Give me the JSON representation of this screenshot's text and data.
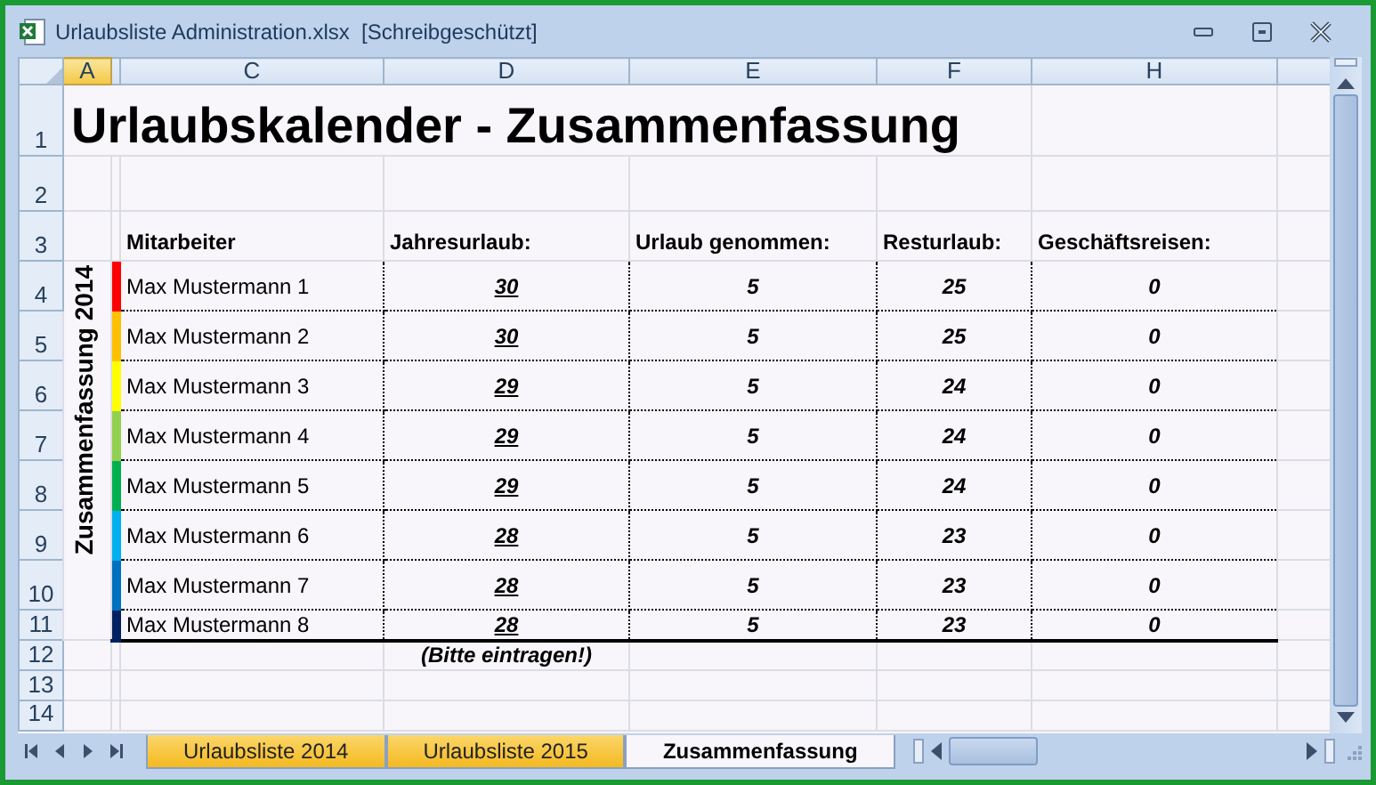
{
  "window": {
    "title": "Urlaubsliste Administration.xlsx  [Schreibgeschützt]"
  },
  "column_headers": [
    {
      "label": "A",
      "selected": true
    },
    {
      "selected": false
    },
    {
      "label": "C",
      "selected": false
    },
    {
      "label": "D",
      "selected": false
    },
    {
      "label": "E",
      "selected": false
    },
    {
      "label": "F",
      "selected": false
    },
    {
      "label": "H",
      "selected": false
    }
  ],
  "row_headers": [
    "1",
    "2",
    "3",
    "4",
    "5",
    "6",
    "7",
    "8",
    "9",
    "10",
    "11",
    "12",
    "13",
    "14"
  ],
  "sheet": {
    "title": "Urlaubskalender - Zusammenfassung",
    "side_label": "Zusammenfassung 2014",
    "columns": [
      "Mitarbeiter",
      "Jahresurlaub:",
      "Urlaub genommen:",
      "Resturlaub:",
      "Geschäftsreisen:"
    ],
    "rows": [
      {
        "color": "#ff0000",
        "name": "Max Mustermann 1",
        "annual": "30",
        "taken": "5",
        "remaining": "25",
        "business_trips": "0"
      },
      {
        "color": "#ffc000",
        "name": "Max Mustermann 2",
        "annual": "30",
        "taken": "5",
        "remaining": "25",
        "business_trips": "0"
      },
      {
        "color": "#ffff00",
        "name": "Max Mustermann 3",
        "annual": "29",
        "taken": "5",
        "remaining": "24",
        "business_trips": "0"
      },
      {
        "color": "#92d050",
        "name": "Max Mustermann 4",
        "annual": "29",
        "taken": "5",
        "remaining": "24",
        "business_trips": "0"
      },
      {
        "color": "#00b050",
        "name": "Max Mustermann 5",
        "annual": "29",
        "taken": "5",
        "remaining": "24",
        "business_trips": "0"
      },
      {
        "color": "#00b0f0",
        "name": "Max Mustermann 6",
        "annual": "28",
        "taken": "5",
        "remaining": "23",
        "business_trips": "0"
      },
      {
        "color": "#0070c0",
        "name": "Max Mustermann 7",
        "annual": "28",
        "taken": "5",
        "remaining": "23",
        "business_trips": "0"
      },
      {
        "color": "#002060",
        "name": "Max Mustermann 8",
        "annual": "28",
        "taken": "5",
        "remaining": "23",
        "business_trips": "0"
      }
    ],
    "note": "(Bitte eintragen!)"
  },
  "sheet_tabs": [
    {
      "label": "Urlaubsliste 2014",
      "selected": false
    },
    {
      "label": "Urlaubsliste 2015",
      "selected": false
    },
    {
      "label": "Zusammenfassung",
      "selected": true
    }
  ]
}
